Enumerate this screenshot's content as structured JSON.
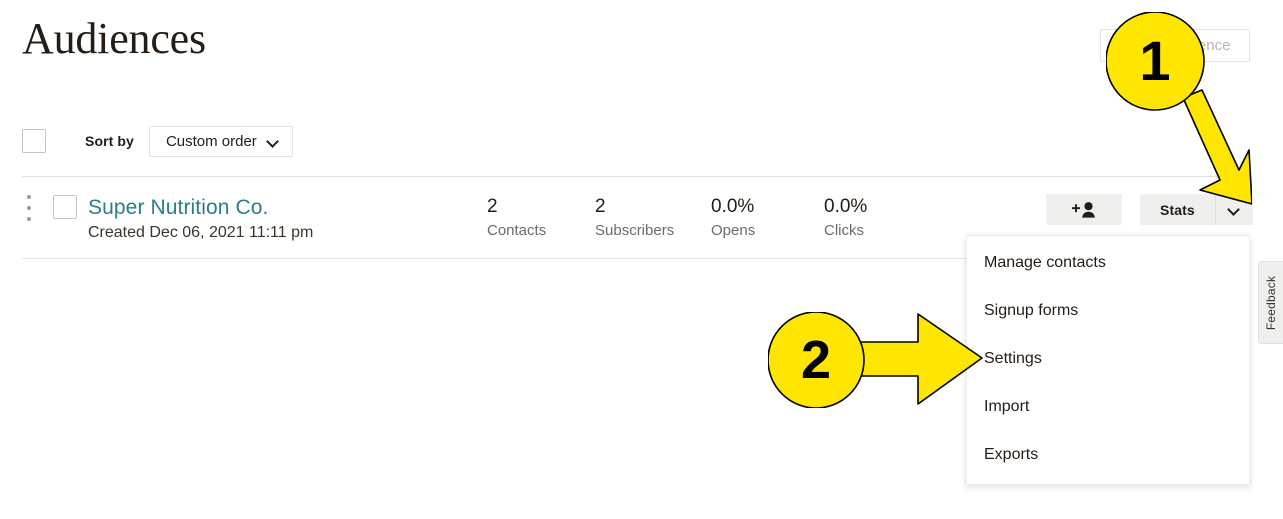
{
  "header": {
    "title": "Audiences",
    "create_button_label": "Create Audience"
  },
  "toolbar": {
    "select_all_checkbox": "",
    "sort_by_label": "Sort by",
    "sort_value": "Custom order",
    "sort_options": [
      "Custom order"
    ],
    "chevron_icon": "chevron-down-icon"
  },
  "audience_row": {
    "drag_handle_icon": "drag-handle-icon",
    "row_checkbox": "",
    "name": "Super Nutrition Co.",
    "created": "Created Dec 06, 2021 11:11 pm",
    "stats": [
      {
        "value": "2",
        "label": "Contacts"
      },
      {
        "value": "2",
        "label": "Subscribers"
      },
      {
        "value": "0.0%",
        "label": "Opens"
      },
      {
        "value": "0.0%",
        "label": "Clicks"
      }
    ],
    "add_contact_icon": "add-person-icon",
    "stats_button_label": "Stats",
    "stats_caret_icon": "chevron-down-icon"
  },
  "actions_menu": {
    "items": [
      {
        "label": "Manage contacts"
      },
      {
        "label": "Signup forms"
      },
      {
        "label": "Settings"
      },
      {
        "label": "Import"
      },
      {
        "label": "Exports"
      }
    ]
  },
  "feedback": {
    "label": "Feedback"
  },
  "callouts": [
    {
      "number": "1",
      "target": "stats-caret-button"
    },
    {
      "number": "2",
      "target": "menu-item-settings"
    }
  ],
  "colors": {
    "accent_link": "#2a7e8c",
    "callout_yellow": "#FFE600",
    "button_gray": "#efefed",
    "border_gray": "#e3e3e1",
    "text_primary": "#241c15",
    "text_muted": "#6c6c69",
    "disabled_text": "#b7b7b4"
  }
}
